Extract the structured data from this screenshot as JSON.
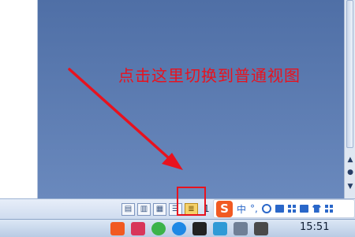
{
  "annotation": {
    "text": "点击这里切换到普通视图"
  },
  "scrollbar": {
    "prev_page_label": "▲",
    "select_browse_label": "●",
    "next_page_label": "▼"
  },
  "statusbar": {
    "view_buttons": [
      {
        "label": "▤",
        "icon": "normal-view-icon"
      },
      {
        "label": "▥",
        "icon": "web-layout-view-icon"
      },
      {
        "label": "▦",
        "icon": "print-layout-view-icon"
      },
      {
        "label": "☰",
        "icon": "outline-view-icon"
      },
      {
        "label": "≣",
        "icon": "reading-view-icon"
      }
    ],
    "zoom_partial": "1"
  },
  "ime": {
    "logo": "S",
    "mode_label": "中",
    "punct_label": "°,"
  },
  "taskbar": {
    "clock": "15:51"
  },
  "colors": {
    "accent_red": "#e8121e",
    "workspace_blue": "#5d7fb8",
    "sogou_orange": "#f15a22"
  }
}
